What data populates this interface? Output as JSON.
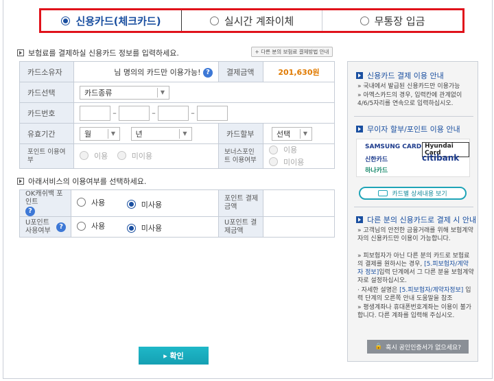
{
  "tabs": [
    {
      "label": "신용카드(체크카드)",
      "selected": true
    },
    {
      "label": "실시간 계좌이체",
      "selected": false
    },
    {
      "label": "무통장 입금",
      "selected": false
    }
  ],
  "section1": {
    "title": "보험료를 결제하실 신용카드 정보를 입력하세요.",
    "other_card_button": "+ 다른 분의 보험료 결제방법 안내"
  },
  "card_form": {
    "holder_label": "카드소유자",
    "holder_value": "님 명의의 카드만 이용가능!",
    "holder_help": "?",
    "amount_label": "결제금액",
    "amount_value": "201,630원",
    "card_select_label": "카드선택",
    "card_type_value": "카드종류",
    "card_number_label": "카드번호",
    "expiry_label": "유효기간",
    "month_value": "월",
    "year_value": "년",
    "installment_label": "카드할부",
    "installment_value": "선택",
    "point_use_label": "포인트 이용여부",
    "bonus_point_label": "보너스포인트 이용여부",
    "use_option": "이용",
    "nouse_option": "미이용"
  },
  "section2": {
    "title": "아래서비스의 이용여부를 선택하세요."
  },
  "services": [
    {
      "label": "OK캐쉬백 포인트",
      "help": "?",
      "use": "사용",
      "nouse": "미사용",
      "selected": "nouse",
      "amount_label": "포인트 결제금액"
    },
    {
      "label": "U포인트 사용여부",
      "help": "?",
      "use": "사용",
      "nouse": "미사용",
      "selected": "nouse",
      "amount_label": "U포인트 결제금액"
    }
  ],
  "side_panel": {
    "section1_title": "신용카드 결제 이용 안내",
    "section1_items": [
      "국내에서 발급된 신용카드만 이용가능",
      "아멕스카드의 경우, 입력칸에 관계없이 4/6/5자리를 연속으로 입력하십시오."
    ],
    "section2_title": "무이자 할부/포인트 이용 안내",
    "logos": [
      "SAMSUNG CARD",
      "Hyundai Card",
      "신한카드",
      "citibank",
      "하나카드"
    ],
    "card_detail_button": "카드별 상세내용 보기",
    "section3_title": "다른 분의 신용카드로 결제 시 안내",
    "section3_item1": "고객님의 안전한 금융거래를 위해 보험계약자의 신용카드만 이용이 가능합니다.",
    "section3_item2_a": "피보험자가 아닌 다른 분의 카드로 보험료의 결제를 원하시는 경우,",
    "section3_item2_link": "[5.피보험자/계약자 정보]",
    "section3_item2_b": "입력 단계에서 그 다른 분을 보험계약자로 설정하십시오.",
    "section3_item3_a": "자세한 설명은",
    "section3_item3_link": "[5.피보험자/계약자정보]",
    "section3_item3_b": "입력 단계의 오른쪽 안내 도움말을 참조",
    "section3_item4": "평생계좌나 휴대폰번호계좌는 이용이 불가합니다. 다른 계좌를 입력해 주십시오.",
    "cert_button": "혹시 공인인증서가 없으세요?"
  },
  "confirm_button": "▸ 확인",
  "colors": {
    "accent": "#1a4fa0",
    "amount": "#e07a00",
    "highlight": "#e0121b",
    "teal": "#15a0b3"
  }
}
